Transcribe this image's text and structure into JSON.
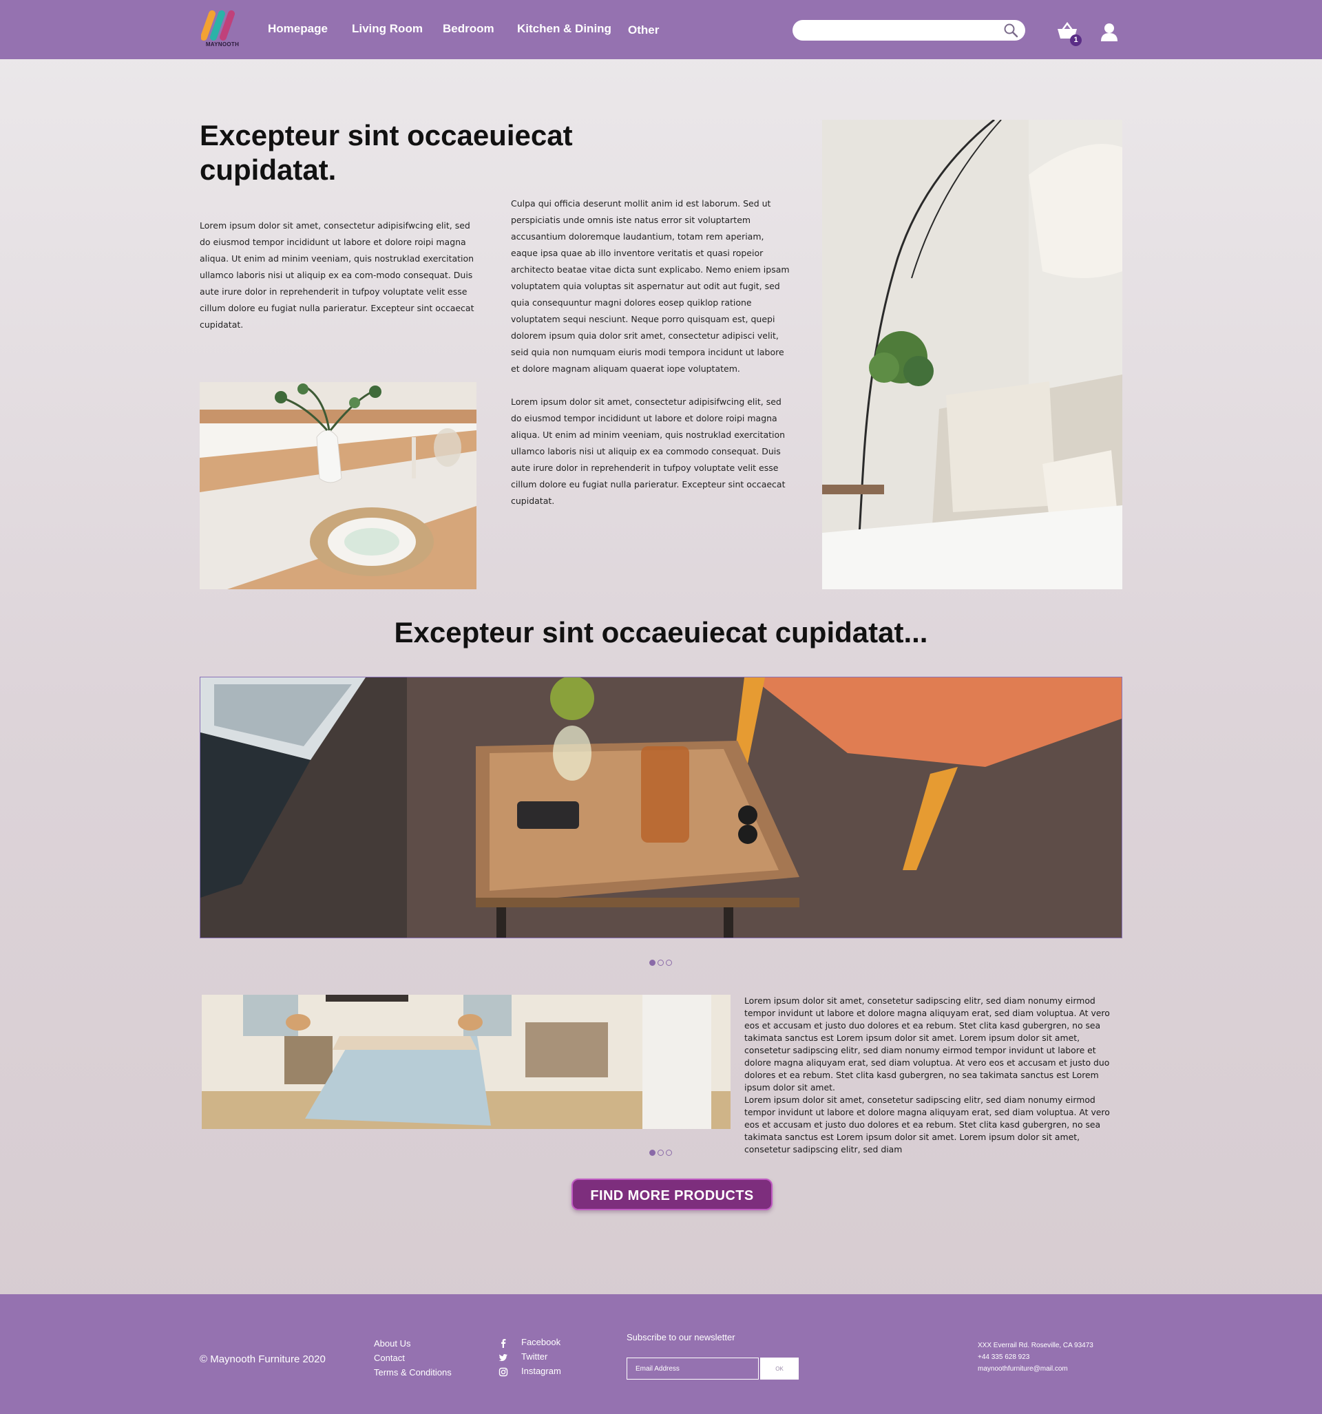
{
  "header": {
    "logo_text": "MAYNOOTH",
    "nav": [
      "Homepage",
      "Living Room",
      "Bedroom",
      "Kitchen & Dining",
      "Other"
    ],
    "search_placeholder": "",
    "cart_count": "1"
  },
  "hero": {
    "title": "Excepteur sint occaeuiecat cupidatat.",
    "left_paragraph": "Lorem ipsum dolor sit amet, consectetur adipisifwcing elit, sed do eiusmod tempor incididunt ut labore et dolore roipi magna aliqua. Ut enim ad minim veeniam, quis nostruklad exercitation ullamco laboris nisi ut aliquip ex ea com-modo consequat. Duis aute irure dolor in reprehenderit in tufpoy voluptate velit esse cillum dolore eu fugiat nulla parieratur. Excepteur sint occaecat cupidatat.",
    "right_paragraph_1": "Culpa qui officia deserunt mollit anim id est laborum. Sed ut perspiciatis unde omnis iste natus error sit voluptartem accusantium doloremque laudantium, totam rem aperiam, eaque ipsa quae ab illo inventore veritatis et quasi ropeior architecto beatae vitae dicta sunt explicabo. Nemo eniem ipsam voluptatem quia voluptas sit aspernatur aut odit aut fugit, sed quia consequuntur magni dolores eosep quiklop ratione voluptatem sequi nesciunt. Neque porro quisquam est, quepi dolorem ipsum quia dolor srit amet, consectetur adipisci velit, seid quia non numquam eiuris modi tempora incidunt ut labore et dolore magnam aliquam quaerat iope voluptatem.",
    "right_paragraph_2": "Lorem ipsum dolor sit amet, consectetur adipisifwcing elit, sed do eiusmod tempor incididunt ut labore et dolore roipi magna aliqua. Ut enim ad minim veeniam, quis nostruklad exercitation ullamco laboris nisi ut aliquip ex ea commodo consequat. Duis aute irure dolor in reprehenderit in tufpoy voluptate velit esse cillum dolore eu fugiat nulla parieratur. Excepteur sint occaecat cupidatat."
  },
  "section": {
    "title": "Excepteur sint occaeuiecat cupidatat...",
    "side_text": "Lorem ipsum dolor sit amet, consetetur sadipscing elitr, sed diam nonumy eirmod tempor invidunt ut labore et dolore magna aliquyam erat, sed diam voluptua. At vero eos et accusam et justo duo dolores et ea rebum. Stet clita kasd gubergren, no sea takimata sanctus est Lorem ipsum dolor sit amet. Lorem ipsum dolor sit amet, consetetur sadipscing elitr, sed diam nonumy eirmod tempor invidunt ut labore et dolore magna aliquyam erat, sed diam voluptua. At vero eos et accusam et justo duo dolores et ea rebum. Stet clita kasd gubergren, no sea takimata sanctus est Lorem ipsum dolor sit amet.",
    "side_text_2": "Lorem ipsum dolor sit amet, consetetur sadipscing elitr, sed diam nonumy eirmod tempor invidunt ut labore et dolore magna aliquyam erat, sed diam voluptua. At vero eos et accusam et justo duo dolores et ea rebum. Stet clita kasd gubergren, no sea takimata sanctus est Lorem ipsum dolor sit amet. Lorem ipsum dolor sit amet, consetetur sadipscing elitr, sed diam",
    "cta": "FIND MORE PRODUCTS"
  },
  "footer": {
    "copyright": "© Maynooth Furniture 2020",
    "links": [
      "About Us",
      "Contact",
      "Terms & Conditions"
    ],
    "social": [
      "Facebook",
      "Twitter",
      "Instagram"
    ],
    "newsletter_title": "Subscribe to our newsletter",
    "email_placeholder": "Email Address",
    "ok_label": "OK",
    "address": "XXX Everrail Rd. Roseville, CA 93473",
    "phone": "+44 335 628 923",
    "email": "maynoothfurniture@mail.com"
  },
  "colors": {
    "brand_purple": "#9572b0",
    "cta_plum": "#7d2e7d",
    "cta_border": "#c05cc3"
  }
}
